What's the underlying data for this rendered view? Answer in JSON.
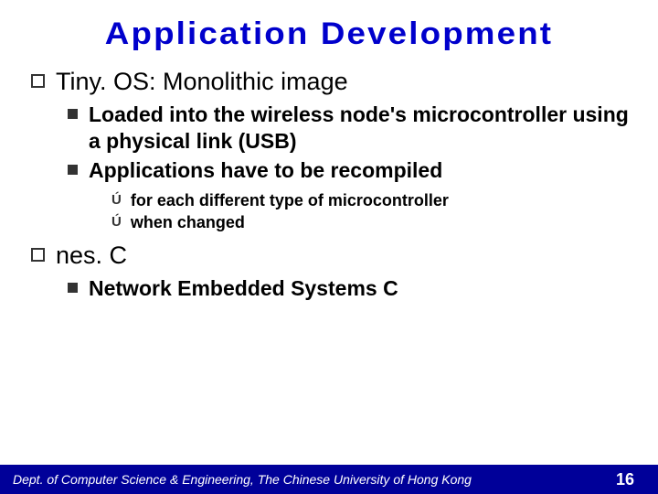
{
  "title": "Application Development",
  "sections": [
    {
      "heading": "Tiny. OS: Monolithic image",
      "items": [
        {
          "text": "Loaded into the wireless node's microcontroller using a physical link (USB)",
          "sub": []
        },
        {
          "text": "Applications have to be recompiled",
          "sub": [
            "for each different type of microcontroller",
            "when changed"
          ]
        }
      ]
    },
    {
      "heading": "nes. C",
      "items": [
        {
          "text": "Network Embedded Systems C",
          "sub": []
        }
      ]
    }
  ],
  "footer": {
    "dept": "Dept. of Computer Science & Engineering, The Chinese University of Hong Kong",
    "page": "16"
  }
}
